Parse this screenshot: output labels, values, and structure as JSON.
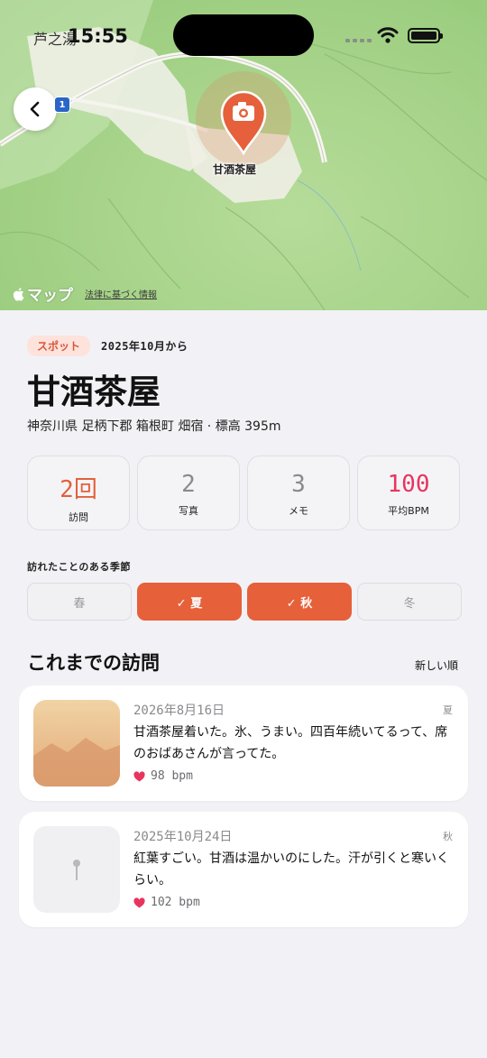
{
  "status_bar": {
    "time": "15:55"
  },
  "map": {
    "top_place_label": "芦之湯",
    "route_number": "1",
    "pin_label": "甘酒茶屋",
    "attribution": "マップ",
    "legal_link": "法律に基づく情報"
  },
  "spot": {
    "badge": "スポット",
    "since": "2025年10月から",
    "name": "甘酒茶屋",
    "location": "神奈川県 足柄下郡 箱根町 畑宿 · 標高 395m"
  },
  "stats": [
    {
      "value": "2回",
      "label": "訪問"
    },
    {
      "value": "2",
      "label": "写真"
    },
    {
      "value": "3",
      "label": "メモ"
    },
    {
      "value": "100",
      "label": "平均BPM"
    }
  ],
  "seasons": {
    "heading": "訪れたことのある季節",
    "items": [
      {
        "label": "春"
      },
      {
        "label": "✓ 夏"
      },
      {
        "label": "✓ 秋"
      },
      {
        "label": "冬"
      }
    ]
  },
  "visits": {
    "heading": "これまでの訪問",
    "sort_label": "新しい順",
    "items": [
      {
        "date": "2026年8月16日",
        "season": "夏",
        "text": "甘酒茶屋着いた。氷、うまい。四百年続いてるって、席のおばあさんが言ってた。",
        "bpm": "98 bpm"
      },
      {
        "date": "2025年10月24日",
        "season": "秋",
        "text": "紅葉すごい。甘酒は温かいのにした。汗が引くと寒いくらい。",
        "bpm": "102 bpm"
      }
    ]
  },
  "colors": {
    "accent": "#e6603a",
    "heart": "#e8345e",
    "badge_bg": "#fde3dc"
  }
}
